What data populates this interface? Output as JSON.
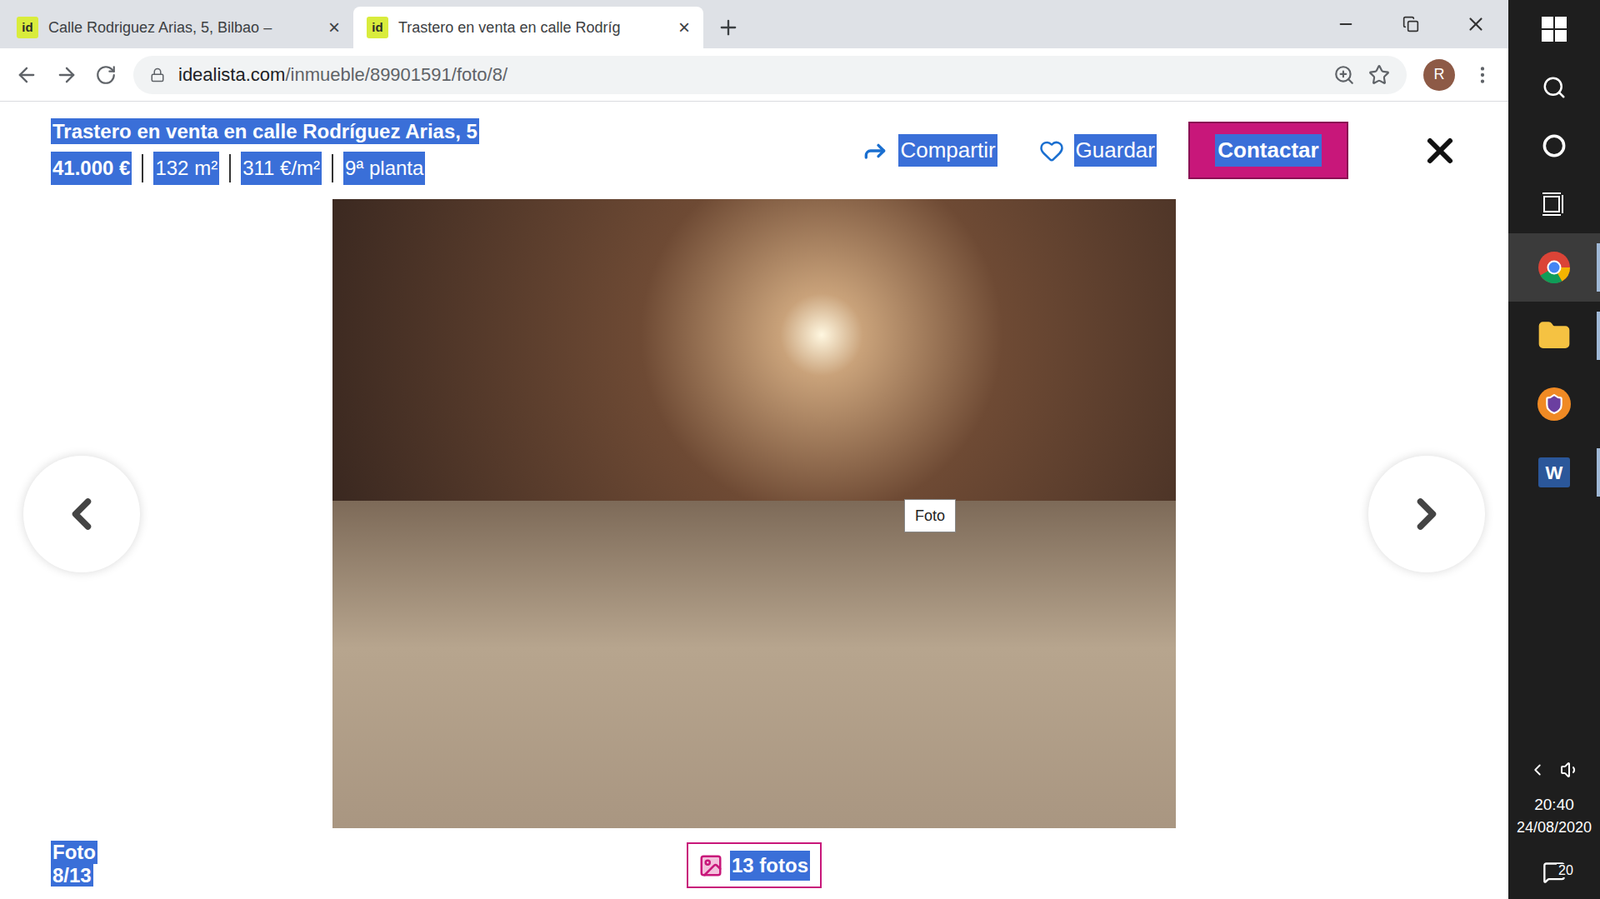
{
  "window": {
    "title": "Trastero en venta en calle Rodríg"
  },
  "tabs": [
    {
      "favicon": "id",
      "label": "Calle Rodriguez Arias, 5, Bilbao –",
      "close": "×",
      "selected": false
    },
    {
      "favicon": "id",
      "label": "Trastero en venta en calle Rodríg",
      "close": "×",
      "selected": true
    }
  ],
  "address_bar": {
    "host": "idealista.com",
    "path": "/inmueble/89901591/foto/8/"
  },
  "profile": {
    "initial": "R"
  },
  "listing": {
    "title": "Trastero en venta en calle Rodríguez Arias, 5",
    "facts": [
      {
        "text": "41.000 €",
        "bold": true
      },
      {
        "text": "132 m²",
        "bold": false
      },
      {
        "text": "311 €/m²",
        "bold": false
      },
      {
        "text": "9ª planta",
        "bold": false
      }
    ],
    "share": "Compartir",
    "save": "Guardar",
    "contact": "Contactar"
  },
  "photo": {
    "tooltip": "Foto"
  },
  "footer": {
    "label": "Foto",
    "counter": "8/13",
    "gallery_button": "13 fotos"
  },
  "taskbar": {
    "apps": [
      {
        "kind": "chrome",
        "selected": true,
        "running": true
      },
      {
        "kind": "explorer",
        "selected": false,
        "running": true
      },
      {
        "kind": "vpn",
        "selected": false,
        "running": false
      },
      {
        "kind": "word",
        "selected": false,
        "running": true,
        "glyph": "W"
      }
    ],
    "time": "20:40",
    "date": "24/08/2020",
    "notifications": "20"
  }
}
